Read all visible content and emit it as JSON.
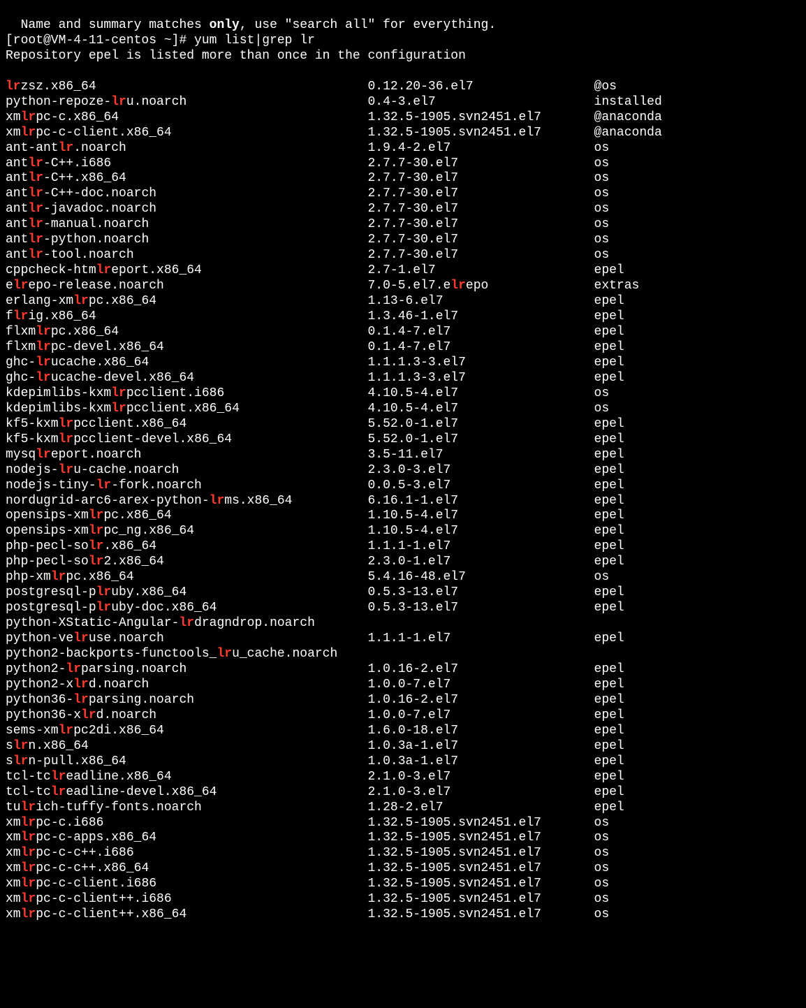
{
  "preamble": {
    "note_pre": "  Name and summary matches ",
    "note_bold": "only",
    "note_post": ", use \"search all\" for everything.",
    "prompt": "[root@VM-4-11-centos ~]# ",
    "command": "yum list|grep lr",
    "warning": "Repository epel is listed more than once in the configuration"
  },
  "match": "lr",
  "rows": [
    {
      "name": "lrzsz.x86_64",
      "ver": "0.12.20-36.el7",
      "repo": "@os"
    },
    {
      "name": "python-repoze-lru.noarch",
      "ver": "0.4-3.el7",
      "repo": "installed"
    },
    {
      "name": "xmlrpc-c.x86_64",
      "ver": "1.32.5-1905.svn2451.el7",
      "repo": "@anaconda"
    },
    {
      "name": "xmlrpc-c-client.x86_64",
      "ver": "1.32.5-1905.svn2451.el7",
      "repo": "@anaconda"
    },
    {
      "name": "ant-antlr.noarch",
      "ver": "1.9.4-2.el7",
      "repo": "os"
    },
    {
      "name": "antlr-C++.i686",
      "ver": "2.7.7-30.el7",
      "repo": "os"
    },
    {
      "name": "antlr-C++.x86_64",
      "ver": "2.7.7-30.el7",
      "repo": "os"
    },
    {
      "name": "antlr-C++-doc.noarch",
      "ver": "2.7.7-30.el7",
      "repo": "os"
    },
    {
      "name": "antlr-javadoc.noarch",
      "ver": "2.7.7-30.el7",
      "repo": "os"
    },
    {
      "name": "antlr-manual.noarch",
      "ver": "2.7.7-30.el7",
      "repo": "os"
    },
    {
      "name": "antlr-python.noarch",
      "ver": "2.7.7-30.el7",
      "repo": "os"
    },
    {
      "name": "antlr-tool.noarch",
      "ver": "2.7.7-30.el7",
      "repo": "os"
    },
    {
      "name": "cppcheck-htmlreport.x86_64",
      "ver": "2.7-1.el7",
      "repo": "epel"
    },
    {
      "name": "elrepo-release.noarch",
      "ver": "7.0-5.el7.elrepo",
      "repo": "extras"
    },
    {
      "name": "erlang-xmlrpc.x86_64",
      "ver": "1.13-6.el7",
      "repo": "epel"
    },
    {
      "name": "flrig.x86_64",
      "ver": "1.3.46-1.el7",
      "repo": "epel"
    },
    {
      "name": "flxmlrpc.x86_64",
      "ver": "0.1.4-7.el7",
      "repo": "epel"
    },
    {
      "name": "flxmlrpc-devel.x86_64",
      "ver": "0.1.4-7.el7",
      "repo": "epel"
    },
    {
      "name": "ghc-lrucache.x86_64",
      "ver": "1.1.1.3-3.el7",
      "repo": "epel"
    },
    {
      "name": "ghc-lrucache-devel.x86_64",
      "ver": "1.1.1.3-3.el7",
      "repo": "epel"
    },
    {
      "name": "kdepimlibs-kxmlrpcclient.i686",
      "ver": "4.10.5-4.el7",
      "repo": "os"
    },
    {
      "name": "kdepimlibs-kxmlrpcclient.x86_64",
      "ver": "4.10.5-4.el7",
      "repo": "os"
    },
    {
      "name": "kf5-kxmlrpcclient.x86_64",
      "ver": "5.52.0-1.el7",
      "repo": "epel"
    },
    {
      "name": "kf5-kxmlrpcclient-devel.x86_64",
      "ver": "5.52.0-1.el7",
      "repo": "epel"
    },
    {
      "name": "mysqlreport.noarch",
      "ver": "3.5-11.el7",
      "repo": "epel"
    },
    {
      "name": "nodejs-lru-cache.noarch",
      "ver": "2.3.0-3.el7",
      "repo": "epel"
    },
    {
      "name": "nodejs-tiny-lr-fork.noarch",
      "ver": "0.0.5-3.el7",
      "repo": "epel"
    },
    {
      "name": "nordugrid-arc6-arex-python-lrms.x86_64",
      "ver": "6.16.1-1.el7",
      "repo": "epel"
    },
    {
      "name": "opensips-xmlrpc.x86_64",
      "ver": "1.10.5-4.el7",
      "repo": "epel"
    },
    {
      "name": "opensips-xmlrpc_ng.x86_64",
      "ver": "1.10.5-4.el7",
      "repo": "epel"
    },
    {
      "name": "php-pecl-solr.x86_64",
      "ver": "1.1.1-1.el7",
      "repo": "epel"
    },
    {
      "name": "php-pecl-solr2.x86_64",
      "ver": "2.3.0-1.el7",
      "repo": "epel"
    },
    {
      "name": "php-xmlrpc.x86_64",
      "ver": "5.4.16-48.el7",
      "repo": "os"
    },
    {
      "name": "postgresql-plruby.x86_64",
      "ver": "0.5.3-13.el7",
      "repo": "epel"
    },
    {
      "name": "postgresql-plruby-doc.x86_64",
      "ver": "0.5.3-13.el7",
      "repo": "epel"
    },
    {
      "name": "python-XStatic-Angular-lrdragndrop.noarch",
      "ver": "",
      "repo": ""
    },
    {
      "name": "python-velruse.noarch",
      "ver": "1.1.1-1.el7",
      "repo": "epel"
    },
    {
      "name": "python2-backports-functools_lru_cache.noarch",
      "ver": "",
      "repo": ""
    },
    {
      "name": "python2-lrparsing.noarch",
      "ver": "1.0.16-2.el7",
      "repo": "epel"
    },
    {
      "name": "python2-xlrd.noarch",
      "ver": "1.0.0-7.el7",
      "repo": "epel"
    },
    {
      "name": "python36-lrparsing.noarch",
      "ver": "1.0.16-2.el7",
      "repo": "epel"
    },
    {
      "name": "python36-xlrd.noarch",
      "ver": "1.0.0-7.el7",
      "repo": "epel"
    },
    {
      "name": "sems-xmlrpc2di.x86_64",
      "ver": "1.6.0-18.el7",
      "repo": "epel"
    },
    {
      "name": "slrn.x86_64",
      "ver": "1.0.3a-1.el7",
      "repo": "epel"
    },
    {
      "name": "slrn-pull.x86_64",
      "ver": "1.0.3a-1.el7",
      "repo": "epel"
    },
    {
      "name": "tcl-tclreadline.x86_64",
      "ver": "2.1.0-3.el7",
      "repo": "epel"
    },
    {
      "name": "tcl-tclreadline-devel.x86_64",
      "ver": "2.1.0-3.el7",
      "repo": "epel"
    },
    {
      "name": "tulrich-tuffy-fonts.noarch",
      "ver": "1.28-2.el7",
      "repo": "epel"
    },
    {
      "name": "xmlrpc-c.i686",
      "ver": "1.32.5-1905.svn2451.el7",
      "repo": "os"
    },
    {
      "name": "xmlrpc-c-apps.x86_64",
      "ver": "1.32.5-1905.svn2451.el7",
      "repo": "os"
    },
    {
      "name": "xmlrpc-c-c++.i686",
      "ver": "1.32.5-1905.svn2451.el7",
      "repo": "os"
    },
    {
      "name": "xmlrpc-c-c++.x86_64",
      "ver": "1.32.5-1905.svn2451.el7",
      "repo": "os"
    },
    {
      "name": "xmlrpc-c-client.i686",
      "ver": "1.32.5-1905.svn2451.el7",
      "repo": "os"
    },
    {
      "name": "xmlrpc-c-client++.i686",
      "ver": "1.32.5-1905.svn2451.el7",
      "repo": "os"
    },
    {
      "name": "xmlrpc-c-client++.x86_64",
      "ver": "1.32.5-1905.svn2451.el7",
      "repo": "os"
    }
  ]
}
